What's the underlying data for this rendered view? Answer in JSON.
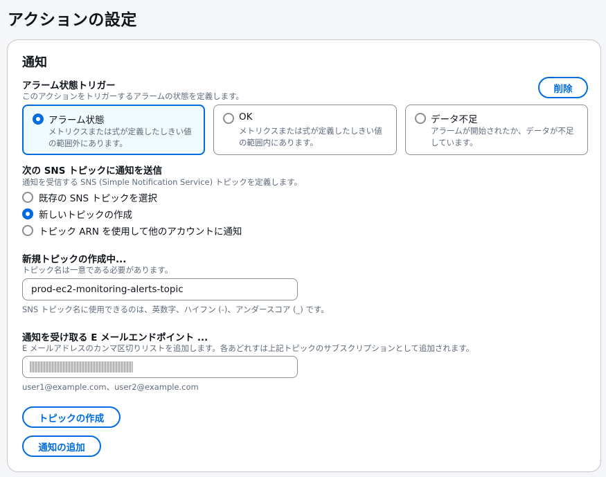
{
  "page": {
    "title": "アクションの設定"
  },
  "notification": {
    "title": "通知",
    "remove_label": "削除",
    "alarm_trigger": {
      "label": "アラーム状態トリガー",
      "description": "このアクションをトリガーするアラームの状態を定義します。",
      "options": [
        {
          "title": "アラーム状態",
          "description": "メトリクスまたは式が定義したしきい値の範囲外にあります。",
          "selected": true
        },
        {
          "title": "OK",
          "description": "メトリクスまたは式が定義したしきい値の範囲内にあります。",
          "selected": false
        },
        {
          "title": "データ不足",
          "description": "アラームが開始されたか、データが不足しています。",
          "selected": false
        }
      ]
    },
    "sns": {
      "label": "次の SNS トピックに通知を送信",
      "description": "通知を受信する SNS (Simple Notification Service) トピックを定義します。",
      "options": [
        {
          "label": "既存の SNS トピックを選択",
          "selected": false
        },
        {
          "label": "新しいトピックの作成",
          "selected": true
        },
        {
          "label": "トピック ARN を使用して他のアカウントに通知",
          "selected": false
        }
      ]
    },
    "new_topic": {
      "label": "新規トピックの作成中...",
      "description": "トピック名は一意である必要があります。",
      "value": "prod-ec2-monitoring-alerts-topic",
      "hint": "SNS トピック名に使用できるのは、英数字、ハイフン (-)、アンダースコア (_) です。"
    },
    "email": {
      "label": "通知を受け取る E メールエンドポイント ...",
      "description": "E メールアドレスのカンマ区切りリストを追加します。各あどれすは上記トピックのサブスクリプションとして追加されます。",
      "hint": "user1@example.com、user2@example.com"
    },
    "create_topic_label": "トピックの作成",
    "add_notification_label": "通知の追加"
  },
  "colors": {
    "accent": "#006ce0",
    "border": "#8c8c94",
    "selected_bg": "#f0fbff",
    "muted_text": "#5f6b7a"
  }
}
